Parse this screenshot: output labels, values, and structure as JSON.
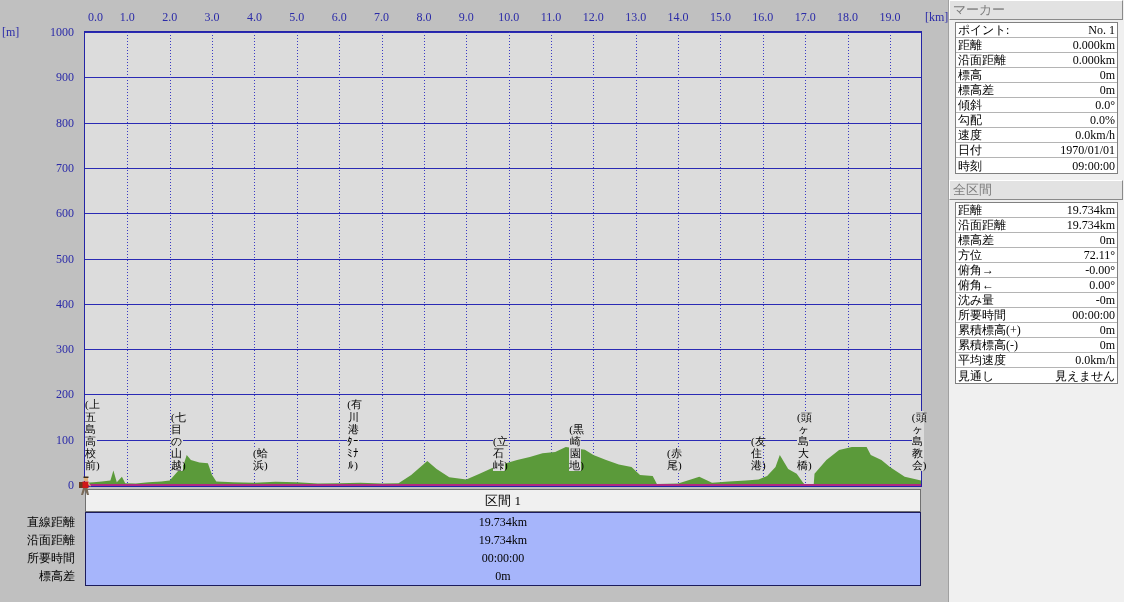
{
  "chart": {
    "chart_data": {
      "type": "area",
      "xlabel": "[km]",
      "ylabel": "[m]",
      "xlim": [
        0,
        19.734
      ],
      "ylim": [
        0,
        1000
      ],
      "grid": true,
      "xticks": [
        {
          "value": 0,
          "label": "0.0"
        },
        {
          "value": 1,
          "label": "1.0"
        },
        {
          "value": 2,
          "label": "2.0"
        },
        {
          "value": 3,
          "label": "3.0"
        },
        {
          "value": 4,
          "label": "4.0"
        },
        {
          "value": 5,
          "label": "5.0"
        },
        {
          "value": 6,
          "label": "6.0"
        },
        {
          "value": 7,
          "label": "7.0"
        },
        {
          "value": 8,
          "label": "8.0"
        },
        {
          "value": 9,
          "label": "9.0"
        },
        {
          "value": 10,
          "label": "10.0"
        },
        {
          "value": 11,
          "label": "11.0"
        },
        {
          "value": 12,
          "label": "12.0"
        },
        {
          "value": 13,
          "label": "13.0"
        },
        {
          "value": 14,
          "label": "14.0"
        },
        {
          "value": 15,
          "label": "15.0"
        },
        {
          "value": 16,
          "label": "16.0"
        },
        {
          "value": 17,
          "label": "17.0"
        },
        {
          "value": 18,
          "label": "18.0"
        },
        {
          "value": 19,
          "label": "19.0"
        }
      ],
      "yticks": [
        0,
        100,
        200,
        300,
        400,
        500,
        600,
        700,
        800,
        900,
        1000
      ],
      "x": [
        0,
        0.2,
        0.4,
        0.6,
        0.67,
        0.75,
        0.87,
        0.95,
        1.2,
        1.5,
        1.8,
        2.0,
        2.33,
        2.4,
        2.5,
        2.7,
        2.9,
        3.0,
        3.1,
        3.5,
        4.0,
        4.5,
        5.0,
        5.5,
        6.0,
        6.5,
        7.0,
        7.4,
        7.7,
        8.08,
        8.3,
        8.6,
        9.0,
        9.3,
        9.6,
        10.0,
        10.2,
        10.5,
        10.8,
        11.1,
        11.35,
        11.8,
        12.0,
        12.3,
        12.6,
        12.9,
        13.1,
        13.4,
        13.5,
        14.0,
        14.3,
        14.5,
        14.8,
        15.2,
        15.6,
        15.9,
        16.1,
        16.3,
        16.4,
        16.6,
        16.8,
        16.95,
        17.0,
        17.2,
        17.22,
        17.5,
        17.8,
        18.1,
        18.45,
        18.55,
        18.8,
        19.0,
        19.35,
        19.734
      ],
      "values": [
        5,
        6,
        8,
        10,
        32,
        6,
        18,
        4,
        3,
        6,
        8,
        10,
        45,
        66,
        55,
        50,
        48,
        22,
        8,
        6,
        5,
        7,
        6,
        3,
        4,
        5,
        3,
        4,
        22,
        53,
        35,
        17,
        12,
        24,
        37,
        50,
        55,
        62,
        70,
        73,
        84,
        78,
        66,
        55,
        45,
        40,
        22,
        20,
        2,
        3,
        12,
        18,
        5,
        8,
        10,
        12,
        20,
        40,
        66,
        35,
        25,
        5,
        0,
        0,
        25,
        55,
        77,
        84,
        84,
        66,
        55,
        40,
        18,
        10
      ],
      "annotations": [
        "(上五島高校前)",
        "(七目の山越)",
        "(蛤浜)",
        "(有川港ﾀｰﾐﾅﾙ)",
        "(立石峠)",
        "(黒崎園地)",
        "(赤尾)",
        "(友住港)",
        "(頭ヶ島大橋)",
        "(頭ヶ島教会)"
      ]
    }
  },
  "segment_table": {
    "header": "区間 1",
    "rows": [
      {
        "label": "直線距離",
        "value": "19.734km"
      },
      {
        "label": "沿面距離",
        "value": "19.734km"
      },
      {
        "label": "所要時間",
        "value": "00:00:00"
      },
      {
        "label": "標高差",
        "value": "0m"
      }
    ]
  },
  "panels": [
    {
      "title": "マーカー",
      "rows": [
        {
          "label": "ポイント:",
          "value": "No. 1"
        },
        {
          "label": "距離",
          "value": "0.000km"
        },
        {
          "label": "沿面距離",
          "value": "0.000km"
        },
        {
          "label": "標高",
          "value": "0m"
        },
        {
          "label": "標高差",
          "value": "0m"
        },
        {
          "label": "傾斜",
          "value": "0.0°"
        },
        {
          "label": "勾配",
          "value": "0.0%"
        },
        {
          "label": "速度",
          "value": "0.0km/h"
        },
        {
          "label": "日付",
          "value": "1970/01/01"
        },
        {
          "label": "時刻",
          "value": "09:00:00"
        }
      ]
    },
    {
      "title": "全区間",
      "rows": [
        {
          "label": "距離",
          "value": "19.734km"
        },
        {
          "label": "沿面距離",
          "value": "19.734km"
        },
        {
          "label": "標高差",
          "value": "0m"
        },
        {
          "label": "方位",
          "value": "72.11°"
        },
        {
          "label": "俯角→",
          "value": "-0.00°"
        },
        {
          "label": "俯角←",
          "value": "0.00°"
        },
        {
          "label": "沈み量",
          "value": "-0m"
        },
        {
          "label": "所要時間",
          "value": "00:00:00"
        },
        {
          "label": "累積標高(+)",
          "value": "0m"
        },
        {
          "label": "累積標高(-)",
          "value": "0m"
        },
        {
          "label": "平均速度",
          "value": "0.0km/h"
        },
        {
          "label": "見通し",
          "value": "見えません"
        }
      ]
    }
  ]
}
